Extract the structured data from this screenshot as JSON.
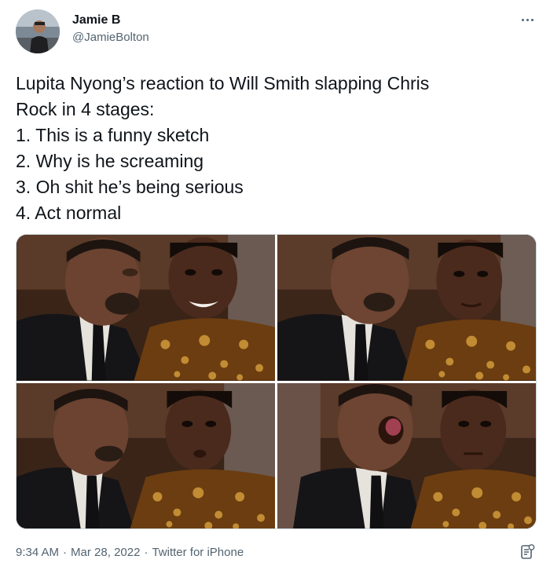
{
  "user": {
    "display_name": "Jamie B",
    "handle": "@JamieBolton",
    "avatar_icon": "profile-photo"
  },
  "tweet": {
    "lines": [
      "Lupita Nyong’s reaction to Will Smith slapping Chris",
      "Rock in 4 stages:",
      "1. This is a funny sketch",
      "2. Why is he screaming",
      "3. Oh shit he’s being serious",
      "4. Act normal"
    ]
  },
  "media": {
    "layout": "2x2 grid",
    "panel_count": 4
  },
  "footer": {
    "time": "9:34 AM",
    "date": "Mar 28, 2022",
    "source": "Twitter for iPhone",
    "separator": "·"
  },
  "colors": {
    "text_primary": "#0f1419",
    "text_secondary": "#536471",
    "border": "#cfd9de",
    "background": "#ffffff"
  },
  "icons": {
    "more": "more-options-icon",
    "analytics": "view-analytics-icon"
  }
}
